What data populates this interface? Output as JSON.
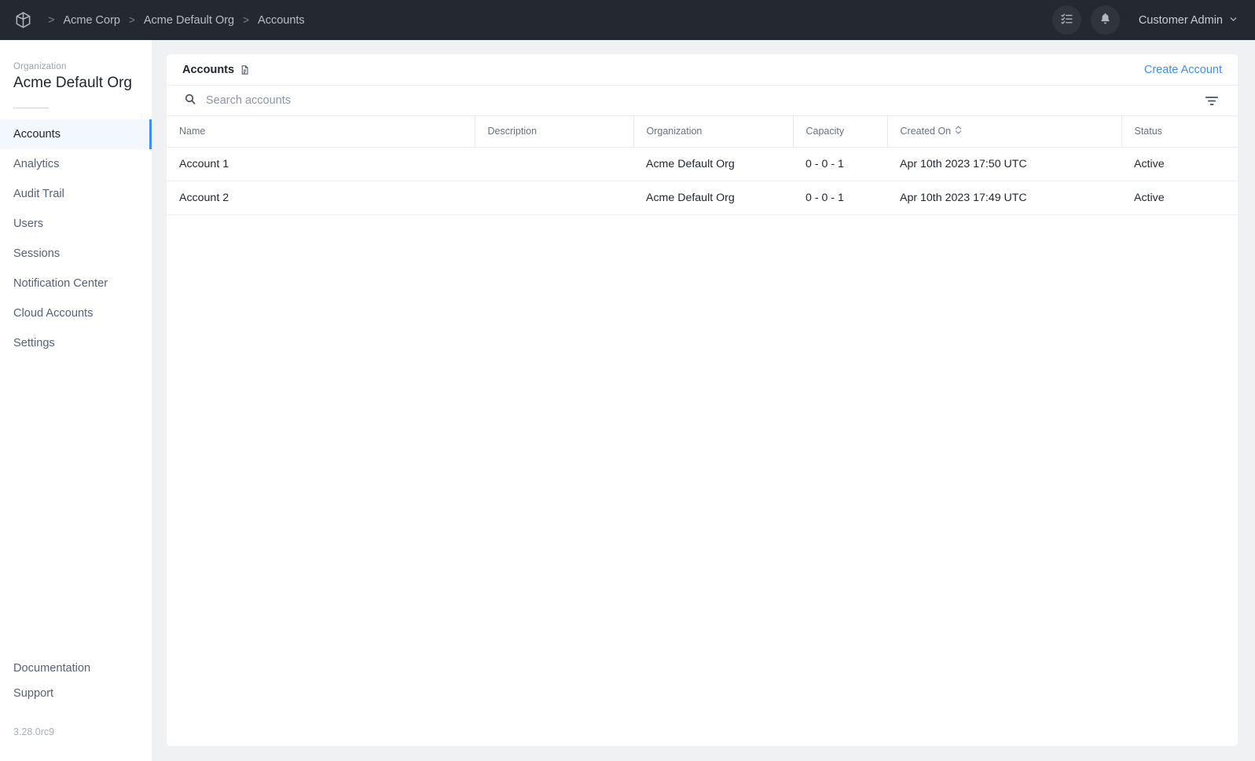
{
  "header": {
    "logo_icon": "cube-icon",
    "breadcrumb": [
      {
        "label": "Acme Corp"
      },
      {
        "label": "Acme Default Org"
      },
      {
        "label": "Accounts"
      }
    ],
    "separator": ">",
    "tasks_icon": "checklist-icon",
    "notifications_icon": "bell-icon",
    "user_menu": "Customer Admin",
    "user_chevron_icon": "chevron-down-icon"
  },
  "sidebar": {
    "org_label": "Organization",
    "org_name": "Acme Default Org",
    "items": [
      {
        "label": "Accounts",
        "active": true
      },
      {
        "label": "Analytics",
        "active": false
      },
      {
        "label": "Audit Trail",
        "active": false
      },
      {
        "label": "Users",
        "active": false
      },
      {
        "label": "Sessions",
        "active": false
      },
      {
        "label": "Notification Center",
        "active": false
      },
      {
        "label": "Cloud Accounts",
        "active": false
      },
      {
        "label": "Settings",
        "active": false
      }
    ],
    "bottom_links": [
      {
        "label": "Documentation"
      },
      {
        "label": "Support"
      }
    ],
    "version": "3.28.0rc9"
  },
  "panel": {
    "title": "Accounts",
    "title_icon": "document-icon",
    "create_label": "Create Account",
    "search_placeholder": "Search accounts",
    "search_value": "",
    "search_icon": "search-icon",
    "filter_icon": "filter-icon"
  },
  "table": {
    "columns": [
      {
        "label": "Name",
        "sortable": false
      },
      {
        "label": "Description",
        "sortable": false
      },
      {
        "label": "Organization",
        "sortable": false
      },
      {
        "label": "Capacity",
        "sortable": false
      },
      {
        "label": "Created On",
        "sortable": true,
        "sort_icon": "sort-chevrons-icon"
      },
      {
        "label": "Status",
        "sortable": false
      }
    ],
    "rows": [
      {
        "name": "Account 1",
        "description": "",
        "organization": "Acme Default Org",
        "capacity": "0 - 0 - 1",
        "created_on": "Apr 10th 2023 17:50 UTC",
        "status": "Active"
      },
      {
        "name": "Account 2",
        "description": "",
        "organization": "Acme Default Org",
        "capacity": "0 - 0 - 1",
        "created_on": "Apr 10th 2023 17:49 UTC",
        "status": "Active"
      }
    ]
  },
  "colors": {
    "header_bg": "#242931",
    "accent_blue": "#3d8ef5",
    "active_nav_bg": "#f2f8fe",
    "page_bg": "#f0f1f3"
  }
}
